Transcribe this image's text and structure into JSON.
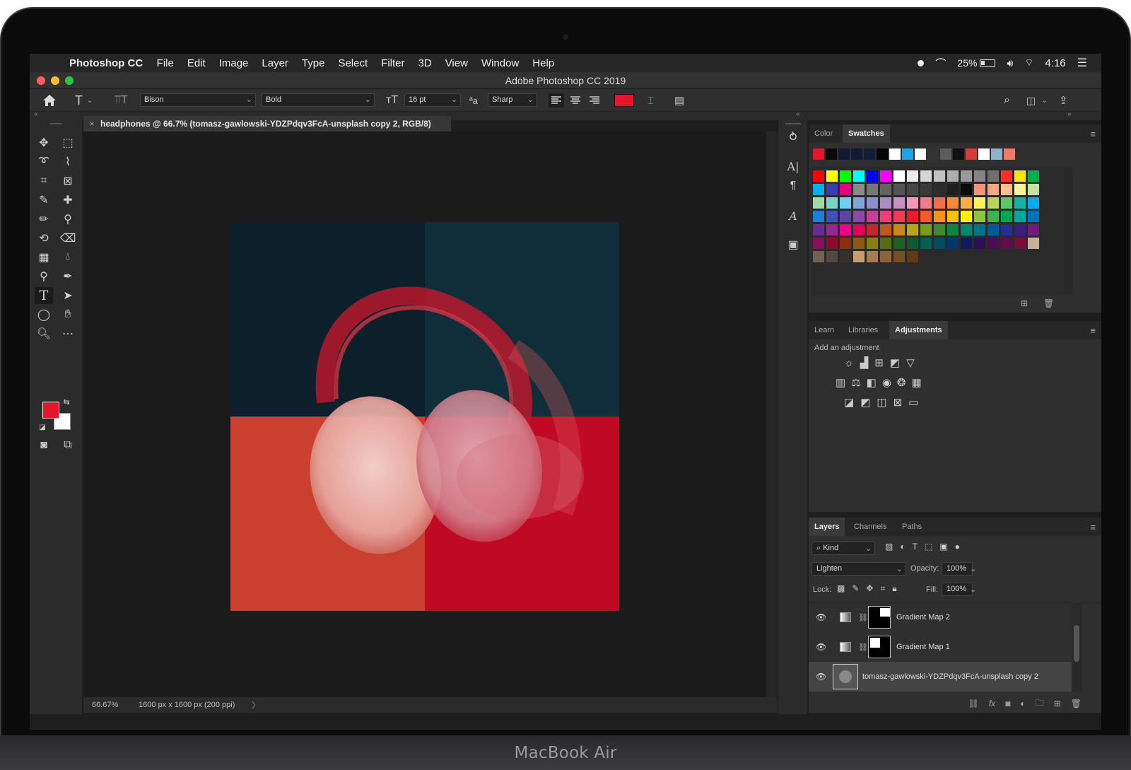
{
  "device": {
    "label": "MacBook Air"
  },
  "menubar": {
    "app_name": "Photoshop CC",
    "items": [
      "File",
      "Edit",
      "Image",
      "Layer",
      "Type",
      "Select",
      "Filter",
      "3D",
      "View",
      "Window",
      "Help"
    ],
    "battery": "25%",
    "time": "4:16"
  },
  "window": {
    "title": "Adobe Photoshop CC 2019"
  },
  "options_bar": {
    "font_family": "Bison",
    "font_style": "Bold",
    "font_size": "16 pt",
    "antialias_label": "ªa",
    "antialias": "Sharp",
    "text_color": "#e8152a"
  },
  "document": {
    "tab_title": "headphones @ 66.7% (tomasz-gawlowski-YDZPdqv3FcA-unsplash copy 2, RGB/8)",
    "zoom": "66.67%",
    "dimensions": "1600 px x 1600 px (200 ppi)"
  },
  "tools": {
    "foreground_color": "#e8152a",
    "background_color": "#ffffff"
  },
  "color_panel": {
    "tabs": [
      "Color",
      "Swatches"
    ],
    "active_tab": "Swatches",
    "recent": [
      "#e8152a",
      "#0a0a0a",
      "#101a33",
      "#101a33",
      "#111c38",
      "#050505",
      "#ffffff",
      "#1fa3e6",
      "#ffffff",
      "#333333",
      "#5c5c5c",
      "#111111",
      "#d83a3a",
      "#ffffff",
      "#8fb3cc",
      "#f07a6a"
    ],
    "swatches": [
      [
        "#ff0000",
        "#ffff00",
        "#00ff00",
        "#00ffff",
        "#0000ff",
        "#ff00ff",
        "#ffffff",
        "#ebebeb",
        "#d6d6d6",
        "#c2c2c2",
        "#adadad",
        "#999999",
        "#858585",
        "#707070",
        "#ff2d2d",
        "#ffe600",
        "#00b050"
      ],
      [
        "#00b0f0",
        "#3b3bb5",
        "#e6007e",
        "#8a8a8a",
        "#777777",
        "#636363",
        "#545454",
        "#474747",
        "#3a3a3a",
        "#2d2d2d",
        "#1f1f1f",
        "#0a0a0a",
        "#f6937a",
        "#f9a77e",
        "#fcc08c",
        "#fdf59a",
        "#c3e3a3"
      ],
      [
        "#a3d9a5",
        "#79d6c6",
        "#6fcff4",
        "#7fa7d9",
        "#8d8fcf",
        "#a98cc6",
        "#c990c4",
        "#f396b9",
        "#f47b89",
        "#f26d4a",
        "#f58a3c",
        "#f9ae42",
        "#fff25a",
        "#b4d75a",
        "#5fc56b",
        "#11b3a2",
        "#00aeef"
      ],
      [
        "#1f7fd6",
        "#3f51b5",
        "#5a45a7",
        "#8d47a6",
        "#c2409a",
        "#ee3f78",
        "#ee3b54",
        "#ed1c24",
        "#f25a29",
        "#f7931d",
        "#fcc10f",
        "#fff100",
        "#8cc63f",
        "#39b54a",
        "#00a651",
        "#00a99d",
        "#0072bc"
      ],
      [
        "#662d91",
        "#92278f",
        "#ec008c",
        "#e6005c",
        "#c1272d",
        "#c1571b",
        "#c58a1a",
        "#b8a416",
        "#7a9a1f",
        "#3f8a2f",
        "#12823f",
        "#00876f",
        "#00738c",
        "#005b99",
        "#21318f",
        "#3c1d80",
        "#6f1c7e"
      ],
      [
        "#8b0f5c",
        "#8c0d2b",
        "#8c2c11",
        "#8c5a0e",
        "#8a7d12",
        "#566d15",
        "#1f6125",
        "#0a5a32",
        "#005e53",
        "#004d63",
        "#00376b",
        "#111a5e",
        "#2b0f57",
        "#4b0c57",
        "#620b4f",
        "#7a0c3d",
        "#c7b299"
      ],
      [
        "#736357",
        "#534741",
        "#362f2d",
        "#c69c6d",
        "#a67c52",
        "#8c6239",
        "#754c24",
        "#603913"
      ]
    ]
  },
  "adjustments_panel": {
    "tabs": [
      "Learn",
      "Libraries",
      "Adjustments"
    ],
    "active_tab": "Adjustments",
    "heading": "Add an adjustment"
  },
  "layers_panel": {
    "tabs": [
      "Layers",
      "Channels",
      "Paths"
    ],
    "active_tab": "Layers",
    "filter_kind": "Kind",
    "blend_mode": "Lighten",
    "opacity_label": "Opacity:",
    "opacity": "100%",
    "lock_label": "Lock:",
    "fill_label": "Fill:",
    "fill": "100%",
    "layers": [
      {
        "name": "Gradient Map 2"
      },
      {
        "name": "Gradient Map 1"
      },
      {
        "name": "tomasz-gawlowski-YDZPdqv3FcA-unsplash copy 2"
      }
    ],
    "footer_fx": "fx"
  }
}
